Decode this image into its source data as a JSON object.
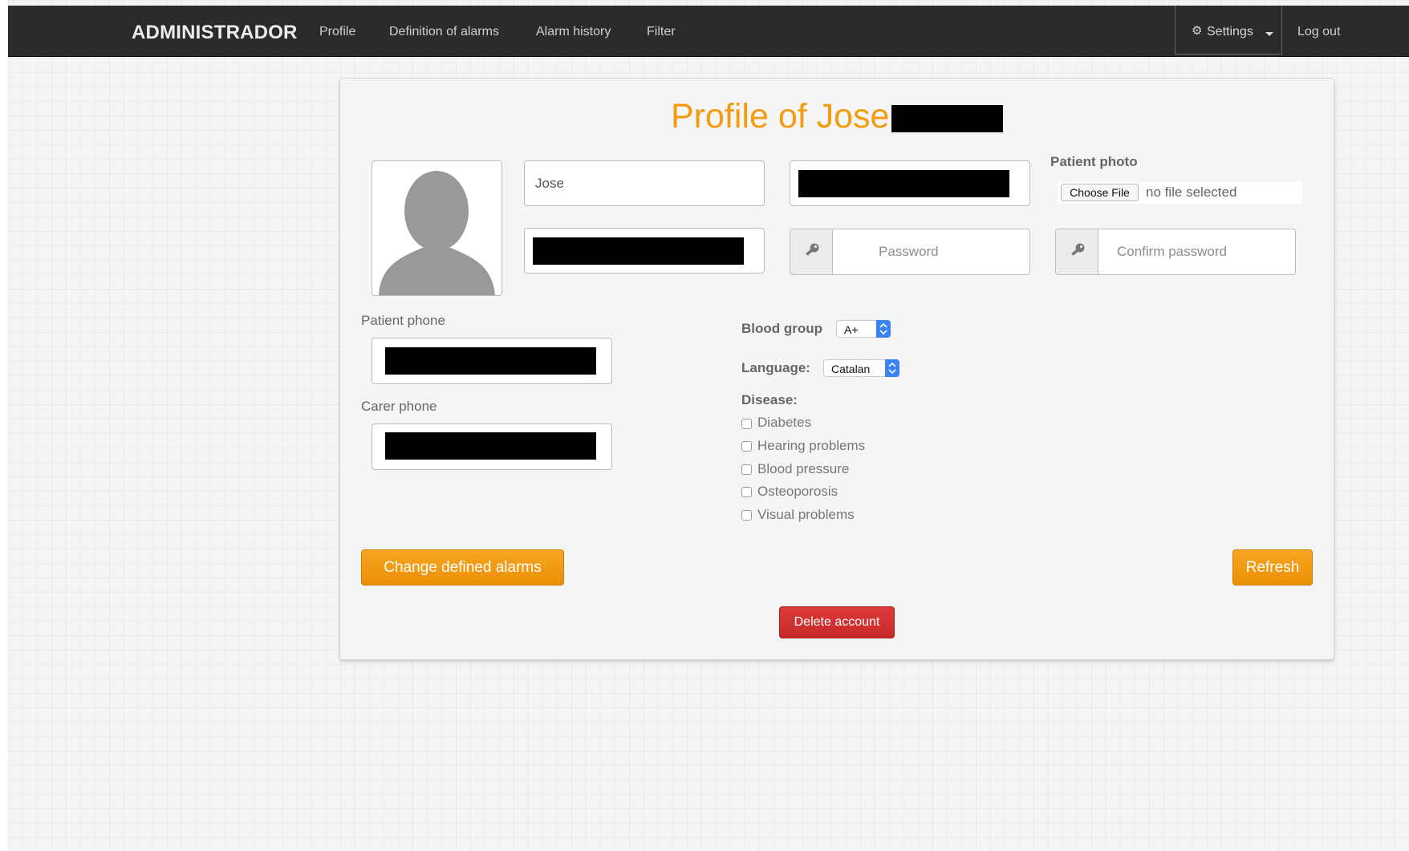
{
  "navbar": {
    "brand": "ADMINISTRADOR",
    "links": [
      "Profile",
      "Definition of alarms",
      "Alarm history",
      "Filter"
    ],
    "settings_label": "Settings",
    "logout_label": "Log out"
  },
  "profile": {
    "title": "Profile of Jose",
    "first_name_value": "Jose",
    "password_placeholder": "Password",
    "confirm_password_placeholder": "Confirm password",
    "photo_label": "Patient photo",
    "choose_file_label": "Choose File",
    "no_file_text": "no file selected",
    "patient_phone_label": "Patient phone",
    "carer_phone_label": "Carer phone",
    "blood_group_label": "Blood group",
    "blood_group_value": "A+",
    "language_label": "Language:",
    "language_value": "Catalan",
    "disease_label": "Disease:",
    "diseases": [
      "Diabetes",
      "Hearing problems",
      "Blood pressure",
      "Osteoporosis",
      "Visual problems"
    ],
    "change_alarms_label": "Change defined alarms",
    "refresh_label": "Refresh",
    "delete_label": "Delete account"
  },
  "colors": {
    "accent": "#f39c12",
    "danger": "#c62828",
    "navbar": "#2b2b2b"
  },
  "icons": [
    "gear-icon",
    "key-icon",
    "user-silhouette-icon",
    "chevron-updown-icon"
  ]
}
